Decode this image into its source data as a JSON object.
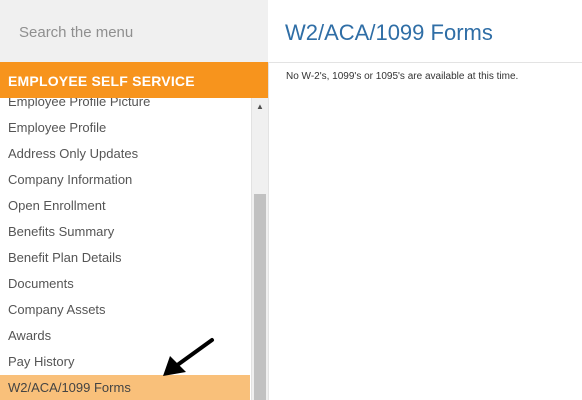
{
  "search": {
    "placeholder": "Search the menu"
  },
  "sidebar": {
    "section_title": "EMPLOYEE SELF SERVICE",
    "items": [
      {
        "label": "Employee Profile Picture"
      },
      {
        "label": "Employee Profile"
      },
      {
        "label": "Address Only Updates"
      },
      {
        "label": "Company Information"
      },
      {
        "label": "Open Enrollment"
      },
      {
        "label": "Benefits Summary"
      },
      {
        "label": "Benefit Plan Details"
      },
      {
        "label": "Documents"
      },
      {
        "label": "Company Assets"
      },
      {
        "label": "Awards"
      },
      {
        "label": "Pay History"
      },
      {
        "label": "W2/ACA/1099 Forms",
        "active": true
      }
    ],
    "scroll_up_icon": "triangle-up"
  },
  "main": {
    "title": "W2/ACA/1099 Forms",
    "message": "No W-2's, 1099's or 1095's are available at this time."
  },
  "colors": {
    "section_header": "#f7941d",
    "active_item": "#f9c07a",
    "title": "#2f6ea6"
  },
  "annotation": {
    "icon": "arrow-icon",
    "color": "#000000"
  }
}
